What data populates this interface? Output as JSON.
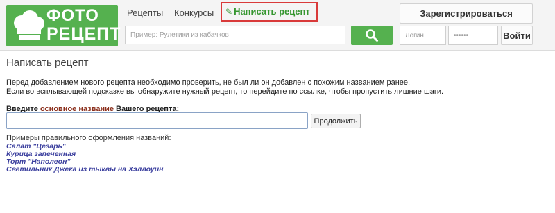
{
  "logo": {
    "line1": "ФОТО",
    "line2": "РЕЦЕПТ"
  },
  "nav": {
    "recipes": "Рецепты",
    "contests": "Конкурсы",
    "write_recipe": "Написать рецепт"
  },
  "search": {
    "placeholder": "Пример: Рулетики из кабачков"
  },
  "auth": {
    "register_label": "Зарегистрироваться",
    "login_placeholder": "Логин",
    "password_placeholder": "••••••",
    "login_button": "Войти"
  },
  "main": {
    "title": "Написать рецепт",
    "intro_lines": [
      "Перед добавлением нового рецепта необходимо проверить, не был ли он добавлен с похожим названием ранее.",
      "Если во всплывающей подсказке вы обнаружите нужный рецепт, то перейдите по ссылке, чтобы пропустить лишние шаги."
    ],
    "label_part1": "Введите ",
    "label_accent": "основное название",
    "label_part2": " Вашего рецепта:",
    "name_value": "",
    "continue_label": "Продолжить",
    "examples_title": "Примеры правильного оформления названий:",
    "examples": [
      "Салат \"Цезарь\"",
      "Курица запеченная",
      "Торт \"Наполеон\"",
      "Светильник Джека из тыквы на Хэллоуин"
    ]
  },
  "colors": {
    "brand_green": "#55b14f",
    "highlight_red": "#d93a3a",
    "link_blue": "#3b3f9e",
    "label_accent": "#8b2f1c"
  },
  "icons": {
    "logo": "chef-hat-icon",
    "search": "search-icon",
    "write": "pencil-icon"
  }
}
